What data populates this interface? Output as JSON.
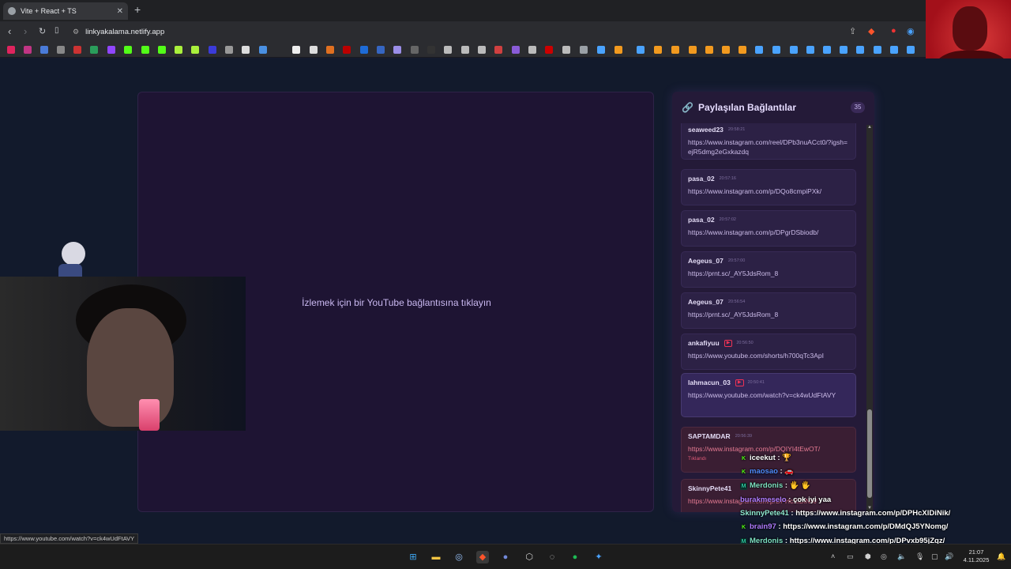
{
  "browser": {
    "tab_title": "Vite + React + TS",
    "tab_close": "✕",
    "new_tab": "+",
    "url": "linkyakalama.netlify.app",
    "status_url": "https://www.youtube.com/watch?v=ck4wUdFtAVY"
  },
  "player": {
    "placeholder": "İzlemek için bir YouTube bağlantısına tıklayın"
  },
  "panel": {
    "title": "Paylaşılan Bağlantılar",
    "count": "35",
    "items": [
      {
        "user": "seaweed23",
        "time": "20:58:21",
        "url": "https://www.instagram.com/reel/DPb3nuACct0/?igsh=ejR5dmg2eGxkazdq",
        "yt": ""
      },
      {
        "user": "pasa_02",
        "time": "20:57:16",
        "url": "https://www.instagram.com/p/DQo8cmpiPXk/",
        "yt": ""
      },
      {
        "user": "pasa_02",
        "time": "20:57:02",
        "url": "https://www.instagram.com/p/DPgrDSbiodb/",
        "yt": ""
      },
      {
        "user": "Aegeus_07",
        "time": "20:57:00",
        "url": "https://prnt.sc/_AY5JdsRom_8",
        "yt": ""
      },
      {
        "user": "Aegeus_07",
        "time": "20:56:54",
        "url": "https://prnt.sc/_AY5JdsRom_8",
        "yt": ""
      },
      {
        "user": "ankafiyuu",
        "time": "20:56:50",
        "url": "https://www.youtube.com/shorts/h700qTc3ApI",
        "yt": "▶"
      },
      {
        "user": "lahmacun_03",
        "time": "20:50:41",
        "url": "https://www.youtube.com/watch?v=ck4wUdFtAVY",
        "yt": "▶"
      },
      {
        "user": "SAPTAMDAR",
        "time": "20:56:39",
        "url": "https://www.instagram.com/p/DQIYI4tEwOT/",
        "yt": "",
        "status": "Tıklandı"
      },
      {
        "user": "SkinnyPete41",
        "time": "",
        "url": "https://www.instagram.com/p/DPHcXlDiNik/",
        "yt": ""
      }
    ]
  },
  "chat": [
    {
      "badge": "K",
      "user": "iceekut",
      "sep": " : ",
      "msg": "",
      "color": "#ffffff"
    },
    {
      "badge": "K",
      "user": "maosao",
      "sep": " : ",
      "msg": "",
      "color": "#4f8cff"
    },
    {
      "badge": "M",
      "user": "Merdonis",
      "sep": " : ",
      "msg": "",
      "color": "#7fe2c2"
    },
    {
      "badge": "",
      "user": "burakmeselo",
      "sep": " : ",
      "msg": "çok iyi yaa",
      "color": "#b07cff"
    },
    {
      "badge": "",
      "user": "SkinnyPete41",
      "sep": " : ",
      "msg": "https://www.instagram.com/p/DPHcXlDiNik/",
      "color": "#8fe8d0"
    },
    {
      "badge": "K",
      "user": "brain97",
      "sep": " : ",
      "msg": "https://www.instagram.com/p/DMdQJ5YNomg/",
      "color": "#b07cff"
    },
    {
      "badge": "M",
      "user": "Merdonis",
      "sep": " : ",
      "msg": "https://www.instagram.com/p/DPvxb95jZqz/",
      "color": "#7fe2c2"
    }
  ],
  "clock": {
    "time": "21:07",
    "date": "4.11.2025"
  },
  "colors": {
    "accent": "#b79cf0",
    "panel_bg": "#241a38",
    "player_bg": "#1e1433",
    "clicked": "#e05a78"
  }
}
